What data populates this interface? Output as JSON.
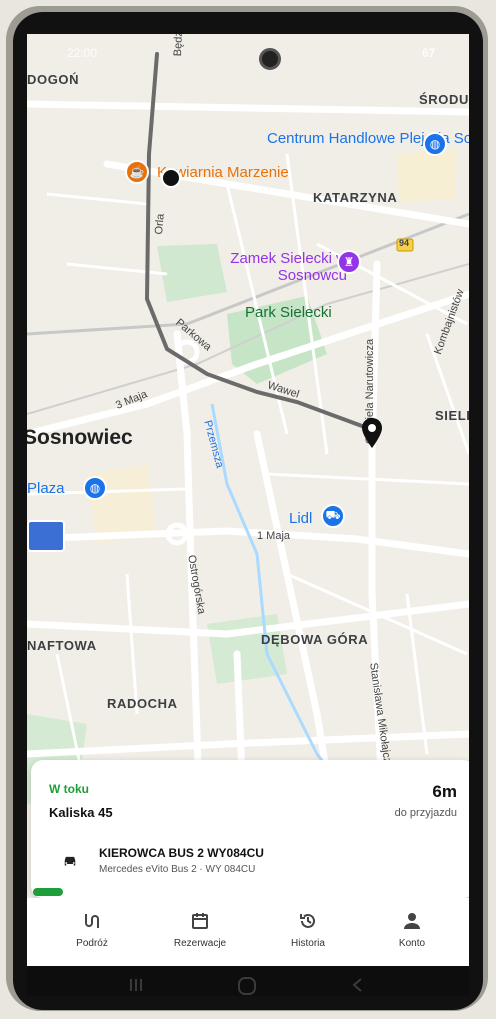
{
  "status_bar": {
    "time": "22:00",
    "battery": "67"
  },
  "map": {
    "areas": [
      "DOGOŃ",
      "ŚRODULA",
      "KATARZYNA",
      "SIELEC",
      "DĘBOWA GÓRA",
      "RADOCHA",
      "NAFTOWA",
      "Sosnowiec"
    ],
    "pois": [
      {
        "name": "Centrum Handlowe Plejada Sosnowiec",
        "icon": "shopping-bag-icon",
        "color": "#1a73e8"
      },
      {
        "name": "Kawiarnia Marzenie",
        "icon": "coffee-cup-icon",
        "color": "#e8710a"
      },
      {
        "name": "Zamek Sielecki w Sosnowcu",
        "icon": "castle-icon",
        "color": "#9334e6"
      },
      {
        "name": "Park Sielecki",
        "icon": "park-icon",
        "color": "#137333"
      },
      {
        "name": "Plaza",
        "icon": "shopping-bag-icon",
        "color": "#1a73e8"
      },
      {
        "name": "Lidl",
        "icon": "shopping-cart-icon",
        "color": "#1a73e8"
      }
    ],
    "streets": [
      "Będzińska",
      "Orla",
      "Parkowa",
      "Wawel",
      "3 Maja",
      "Gabriela Narutowicza",
      "Kombajnistów",
      "Przemsza",
      "1 Maja",
      "Ostrogórska",
      "Stanisława Mikołajczyka",
      "94"
    ],
    "route_color": "#6b6b6b"
  },
  "trip": {
    "status": "W toku",
    "address": "Kaliska 45",
    "eta": "6m",
    "eta_label": "do przyjazdu",
    "driver": "KIEROWCA BUS 2 WY084CU",
    "vehicle": "Mercedes eVito Bus 2 · WY 084CU",
    "status_color": "#1e9e3a"
  },
  "nav": [
    {
      "label": "Podróż",
      "icon": "route-icon"
    },
    {
      "label": "Rezerwacje",
      "icon": "calendar-icon"
    },
    {
      "label": "Historia",
      "icon": "history-icon"
    },
    {
      "label": "Konto",
      "icon": "account-icon"
    }
  ]
}
